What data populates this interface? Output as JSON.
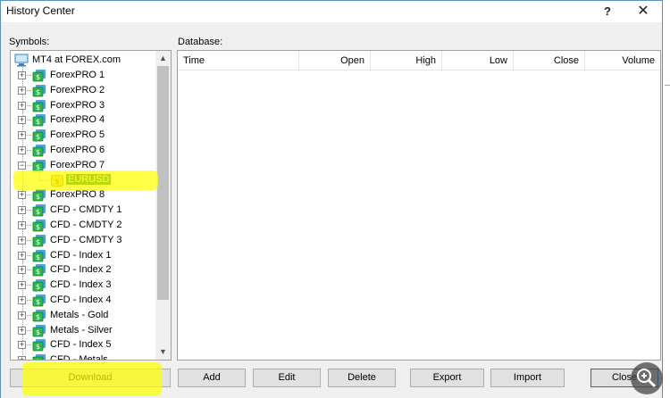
{
  "window": {
    "title": "History Center",
    "help_glyph": "?",
    "close_glyph": "✕"
  },
  "symbols": {
    "label": "Symbols:",
    "root": "MT4 at FOREX.com",
    "items": [
      {
        "label": "ForexPRO 1",
        "expanded": false
      },
      {
        "label": "ForexPRO 2",
        "expanded": false
      },
      {
        "label": "ForexPRO 3",
        "expanded": false
      },
      {
        "label": "ForexPRO 4",
        "expanded": false
      },
      {
        "label": "ForexPRO 5",
        "expanded": false
      },
      {
        "label": "ForexPRO 6",
        "expanded": false
      },
      {
        "label": "ForexPRO 7",
        "expanded": true
      },
      {
        "label": "ForexPRO 8",
        "expanded": false
      },
      {
        "label": "CFD - CMDTY 1",
        "expanded": false
      },
      {
        "label": "CFD - CMDTY 2",
        "expanded": false
      },
      {
        "label": "CFD - CMDTY 3",
        "expanded": false
      },
      {
        "label": "CFD - Index 1",
        "expanded": false
      },
      {
        "label": "CFD - Index 2",
        "expanded": false
      },
      {
        "label": "CFD - Index 3",
        "expanded": false
      },
      {
        "label": "CFD - Index 4",
        "expanded": false
      },
      {
        "label": "Metals - Gold",
        "expanded": false
      },
      {
        "label": "Metals - Silver",
        "expanded": false
      },
      {
        "label": "CFD - Index 5",
        "expanded": false
      },
      {
        "label": "CFD - Metals",
        "expanded": false
      }
    ],
    "child": {
      "parent_index": 6,
      "label": "EURUSD",
      "selected": true
    }
  },
  "database": {
    "label": "Database:",
    "columns": [
      "Time",
      "Open",
      "High",
      "Low",
      "Close",
      "Volume"
    ]
  },
  "buttons": {
    "download": "Download",
    "add": "Add",
    "edit": "Edit",
    "delete": "Delete",
    "export": "Export",
    "import": "Import",
    "close": "Close"
  },
  "colors": {
    "folder_green": "#2db84a",
    "folder_blue": "#4ba3e0",
    "selection": "#0b7a2b",
    "highlight": "#ffff00"
  }
}
